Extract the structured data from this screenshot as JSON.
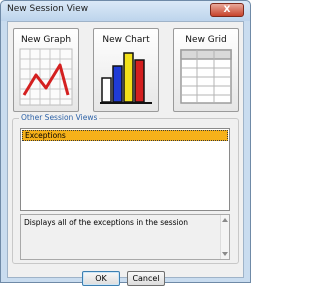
{
  "window": {
    "title": "New Session View",
    "close_label": "X"
  },
  "tiles": [
    {
      "label": "New Graph",
      "icon": "line-graph-icon"
    },
    {
      "label": "New Chart",
      "icon": "bar-chart-icon"
    },
    {
      "label": "New Grid",
      "icon": "grid-icon"
    }
  ],
  "other_views": {
    "group_label": "Other Session Views",
    "items": [
      "Exceptions"
    ],
    "selected": "Exceptions",
    "description": "Displays all of the exceptions in the session"
  },
  "buttons": {
    "ok_label": "OK",
    "cancel_label": "Cancel"
  },
  "colors": {
    "selection": "#f6b119",
    "group_label": "#2d62a7",
    "graph_line": "#d42020",
    "bar_blue": "#1f3bd6",
    "bar_yellow": "#f3e11a",
    "bar_red": "#d41f1f",
    "bar_white": "#ffffff"
  }
}
